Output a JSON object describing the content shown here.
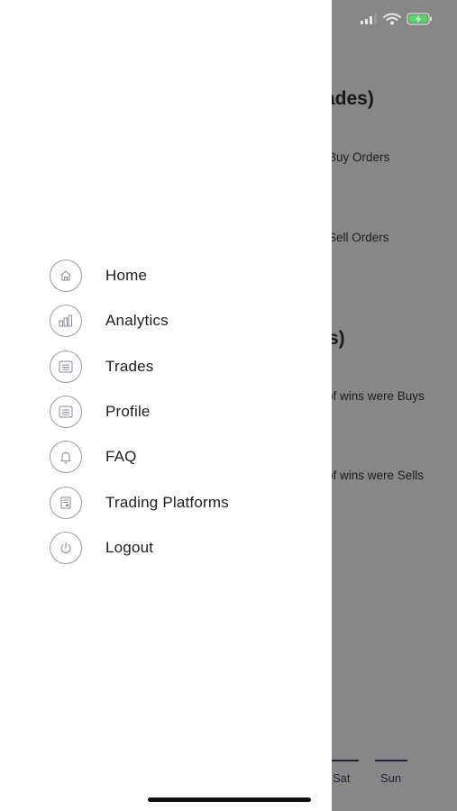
{
  "status_bar": {
    "icons": [
      "cellular-signal-icon",
      "wifi-icon",
      "battery-charging-icon"
    ],
    "battery_color": "#4cd964"
  },
  "background": {
    "heading_trades": "ades)",
    "buy_orders": "Buy Orders",
    "sell_orders": "Sell Orders",
    "heading_wins": "s)",
    "wins_buys": "of wins were Buys",
    "wins_sells": "of wins were Sells",
    "tab_sat": "Sat",
    "tab_sun": "Sun"
  },
  "drawer": {
    "items": [
      {
        "label": "Home",
        "icon": "home-icon"
      },
      {
        "label": "Analytics",
        "icon": "bar-chart-icon"
      },
      {
        "label": "Trades",
        "icon": "list-icon"
      },
      {
        "label": "Profile",
        "icon": "list-icon"
      },
      {
        "label": "FAQ",
        "icon": "bell-icon"
      },
      {
        "label": "Trading Platforms",
        "icon": "document-icon"
      },
      {
        "label": "Logout",
        "icon": "power-icon"
      }
    ]
  },
  "colors": {
    "overlay": "rgba(0,0,0,0.47)",
    "accent": "#3a3f8a",
    "drawer_bg": "#ffffff"
  }
}
